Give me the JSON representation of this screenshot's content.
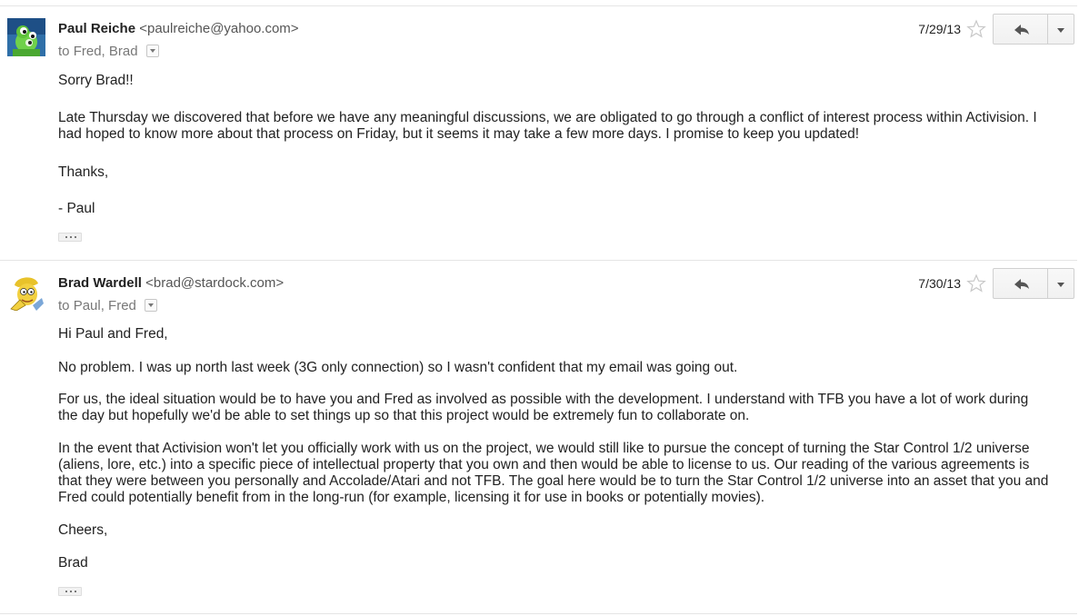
{
  "messages": [
    {
      "sender_name": "Paul Reiche",
      "sender_email": "<paulreiche@yahoo.com>",
      "to_prefix": "to",
      "to_first": "Fred",
      "to_rest": ", Brad",
      "date": "7/29/13",
      "paragraphs": [
        "Sorry Brad!!",
        "Late Thursday we discovered that before we have any meaningful discussions, we are obligated to go through a conflict of interest process within Activision.  I had hoped to know more about that process on Friday, but it seems it may take a few more days.  I promise to keep you updated!",
        "Thanks,",
        "- Paul"
      ]
    },
    {
      "sender_name": "Brad Wardell",
      "sender_email": "<brad@stardock.com>",
      "to_prefix": "to",
      "to_first": "Paul",
      "to_rest": ", Fred",
      "date": "7/30/13",
      "paragraphs": [
        "Hi Paul and Fred,",
        "No problem. I was up north last week (3G only connection) so I wasn't confident that my email was going out.",
        "For us, the ideal situation would be to have you and Fred as involved as possible with the development.  I understand with TFB you have a lot of work during the day but hopefully we'd be able to set things up so that this project would be extremely fun to collaborate on.",
        "In the event that Activision won't let you officially work with us on the project, we would still like to pursue the concept of turning the Star Control 1/2 universe (aliens, lore, etc.) into a specific piece of intellectual property that you own and then would be able to license to us.  Our reading of the various agreements is that they were between you personally and Accolade/Atari and not TFB.   The goal here would be to turn the Star Control 1/2 universe into an asset that you and Fred could potentially benefit from in the long-run (for example, licensing it for use in books or potentially movies).",
        "Cheers,",
        "Brad"
      ]
    }
  ],
  "icons": {
    "star": "star-outline-icon",
    "reply": "reply-arrow-icon",
    "more": "chevron-down-icon",
    "show_trimmed": "ellipsis-icon"
  }
}
